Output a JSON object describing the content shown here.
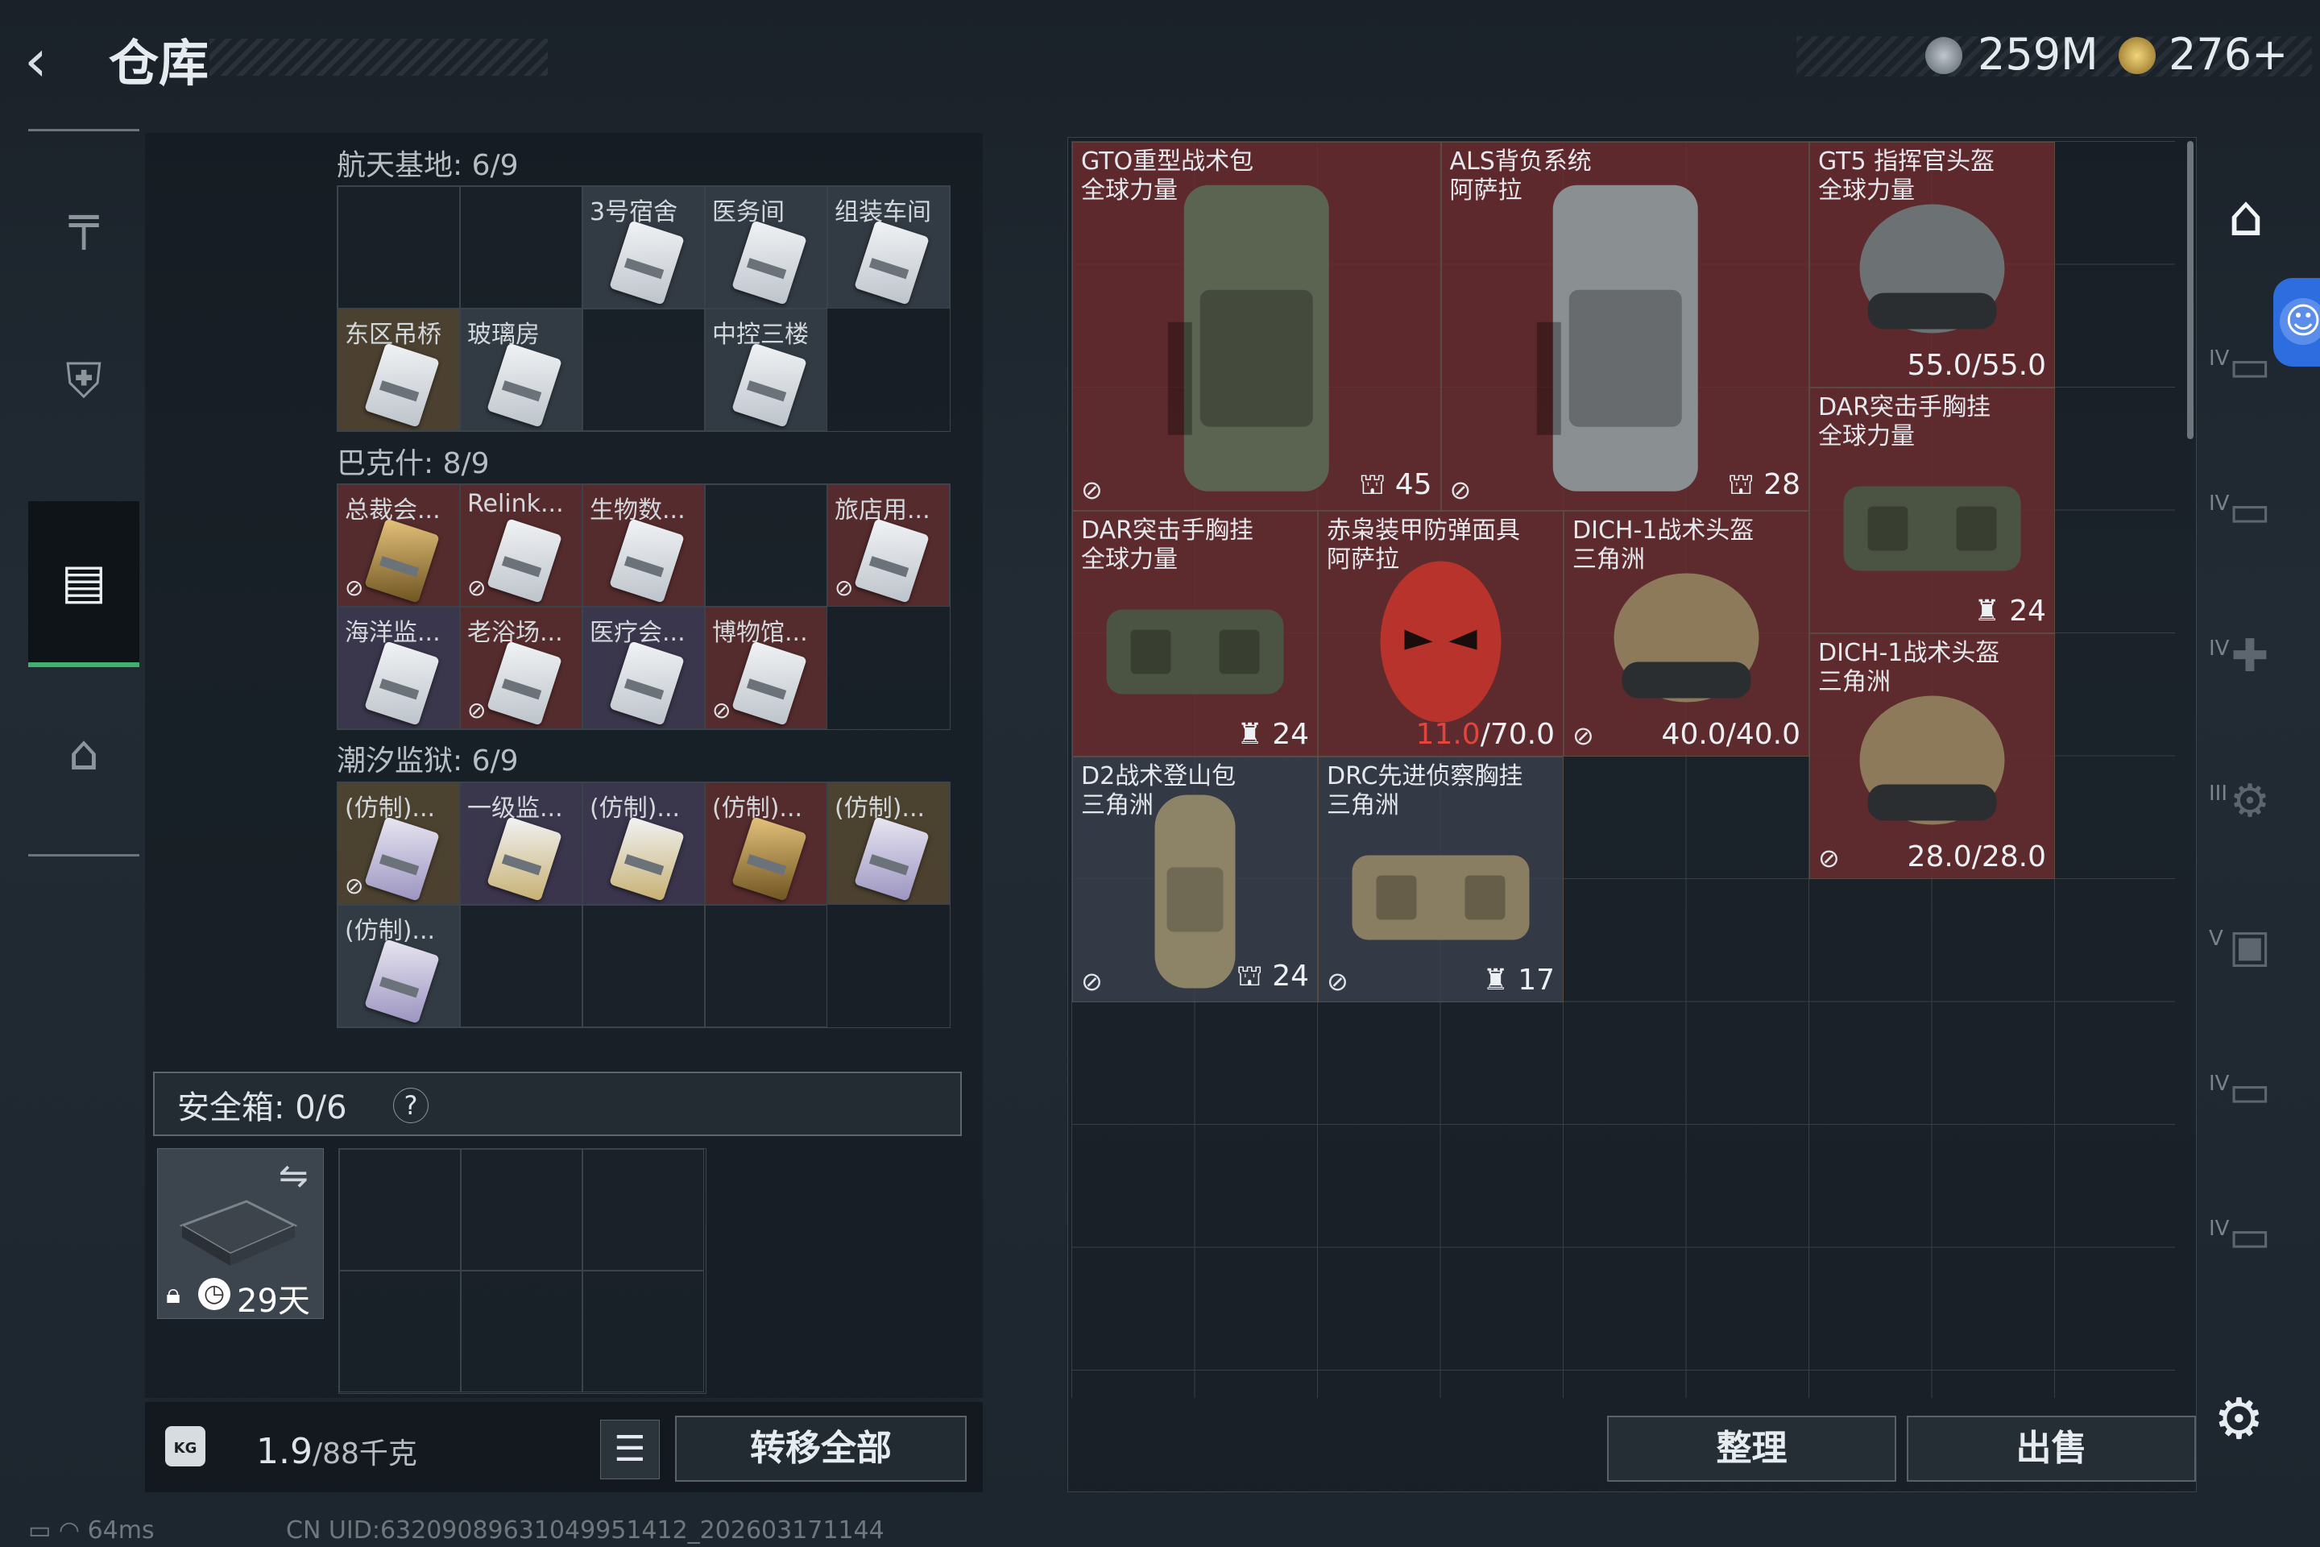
{
  "header": {
    "back_icon": "‹",
    "title": "仓库",
    "currency_1": "259M",
    "currency_2": "276+"
  },
  "nav": {
    "items": [
      {
        "name": "weapon",
        "icon": "╤"
      },
      {
        "name": "backpack",
        "icon": "⛨"
      },
      {
        "name": "storage",
        "icon": "▤"
      },
      {
        "name": "briefcase",
        "icon": "⌂"
      }
    ]
  },
  "keys": {
    "sections": [
      {
        "title": "航天基地: 6/9",
        "cells": [
          {
            "label": "",
            "rarity": "empty"
          },
          {
            "label": "",
            "rarity": "empty"
          },
          {
            "label": "3号宿舍",
            "rarity": "gray"
          },
          {
            "label": "医务间",
            "rarity": "gray"
          },
          {
            "label": "组装车间",
            "rarity": "gray"
          },
          {
            "label": "东区吊桥",
            "rarity": "gold"
          },
          {
            "label": "玻璃房",
            "rarity": "gray"
          },
          {
            "label": "",
            "rarity": "empty"
          },
          {
            "label": "中控三楼",
            "rarity": "gray"
          }
        ]
      },
      {
        "title": "巴克什: 8/9",
        "cells": [
          {
            "label": "总裁会...",
            "rarity": "red",
            "card": "gold",
            "nolock": true
          },
          {
            "label": "Relink...",
            "rarity": "red",
            "nolock": true
          },
          {
            "label": "生物数...",
            "rarity": "red"
          },
          {
            "label": "",
            "rarity": "empty"
          },
          {
            "label": "旅店用...",
            "rarity": "red",
            "nolock": true
          },
          {
            "label": "海洋监...",
            "rarity": "purple"
          },
          {
            "label": "老浴场...",
            "rarity": "red",
            "nolock": true
          },
          {
            "label": "医疗会...",
            "rarity": "purple"
          },
          {
            "label": "博物馆...",
            "rarity": "red",
            "nolock": true
          }
        ]
      },
      {
        "title": "潮汐监狱: 6/9",
        "cells": [
          {
            "label": "(仿制)...",
            "rarity": "gold",
            "card": "purple",
            "nolock": true
          },
          {
            "label": "一级监...",
            "rarity": "purple",
            "card": "gold2"
          },
          {
            "label": "(仿制)...",
            "rarity": "purple",
            "card": "gold2"
          },
          {
            "label": "(仿制)...",
            "rarity": "red",
            "card": "gold"
          },
          {
            "label": "(仿制)...",
            "rarity": "gold",
            "card": "purple"
          },
          {
            "label": "(仿制)...",
            "rarity": "gray",
            "card": "purple"
          },
          {
            "label": "",
            "rarity": "empty"
          },
          {
            "label": "",
            "rarity": "empty"
          },
          {
            "label": "",
            "rarity": "empty"
          }
        ]
      }
    ]
  },
  "safebox": {
    "label": "安全箱: 0/6",
    "help": "?",
    "timer": "29天",
    "swap_icon": "⇋"
  },
  "bottom_left": {
    "weight_value": "1.9",
    "weight_total": "/88千克",
    "weight_icon": "KG",
    "list_icon": "☰",
    "transfer_label": "转移全部"
  },
  "status": {
    "ping": "64ms",
    "uid": "CN UID:6320908963104995141​2_202603171144"
  },
  "items": [
    {
      "name": "GTO重型战术包",
      "sub": "全球力量",
      "value": "45",
      "value_icon": "⛫",
      "rarity": "red",
      "flag": true,
      "shape": "backpack-olive"
    },
    {
      "name": "ALS背负系统",
      "sub": "阿萨拉",
      "value": "28",
      "value_icon": "⛫",
      "rarity": "red",
      "flag": true,
      "shape": "backpack-gray"
    },
    {
      "name": "GT5 指挥官头盔",
      "sub": "全球力量",
      "value": "55.0/55.0",
      "rarity": "red",
      "shape": "helmet-gray"
    },
    {
      "name": "DAR突击手胸挂",
      "sub": "全球力量",
      "value": "24",
      "value_icon": "♜",
      "rarity": "red",
      "shape": "vest-olive"
    },
    {
      "name": "DAR突击手胸挂",
      "sub": "全球力量",
      "value": "24",
      "value_icon": "♜",
      "rarity": "red",
      "shape": "vest-olive"
    },
    {
      "name": "赤枭装甲防弹面具",
      "sub": "阿萨拉",
      "value_hl": "11.0",
      "value": "/70.0",
      "rarity": "red",
      "shape": "mask-red"
    },
    {
      "name": "DICH-1战术头盔",
      "sub": "三角洲",
      "value": "40.0/40.0",
      "rarity": "red",
      "flag": true,
      "shape": "helmet-tan"
    },
    {
      "name": "DICH-1战术头盔",
      "sub": "三角洲",
      "value": "28.0/28.0",
      "rarity": "red",
      "flag": true,
      "shape": "helmet-tan"
    },
    {
      "name": "D2战术登山包",
      "sub": "三角洲",
      "value": "24",
      "value_icon": "⛫",
      "rarity": "gray",
      "flag": true,
      "shape": "bag-tan"
    },
    {
      "name": "DRC先进侦察胸挂",
      "sub": "三角洲",
      "value": "17",
      "value_icon": "♜",
      "rarity": "gray",
      "flag": true,
      "shape": "vest-tan"
    }
  ],
  "bottom_right": {
    "sort_label": "整理",
    "sell_label": "出售"
  },
  "side_tabs": [
    {
      "rom": "IV",
      "icon": "▭"
    },
    {
      "rom": "IV",
      "icon": "▭"
    },
    {
      "rom": "IV",
      "icon": "✚"
    },
    {
      "rom": "III",
      "icon": "⚙"
    },
    {
      "rom": "V",
      "icon": "▣"
    },
    {
      "rom": "IV",
      "icon": "▭"
    },
    {
      "rom": "IV",
      "icon": "▭"
    }
  ],
  "colors": {
    "accent_green": "#3fb06d",
    "rarity_red": "#6c2c2e",
    "rarity_gold": "#5e4e34",
    "rarity_purple": "#463e5a",
    "highlight_red": "#e2453e",
    "access_blue": "#2d6de0"
  }
}
